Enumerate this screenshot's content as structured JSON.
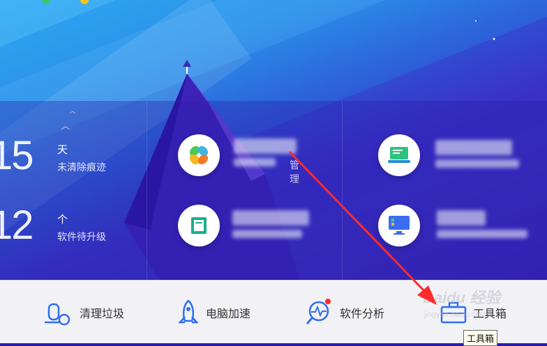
{
  "stats": [
    {
      "number": "15",
      "unit": "天",
      "desc": "未清除痕迹"
    },
    {
      "number": "12",
      "unit": "个",
      "desc": "软件待升级"
    }
  ],
  "cards": [
    {
      "icon": "pinwheel-app-icon",
      "visible_text": "管理"
    },
    {
      "icon": "laptop-app-icon",
      "visible_text": ""
    },
    {
      "icon": "green-document-app-icon",
      "visible_text": ""
    },
    {
      "icon": "monitor-app-icon",
      "visible_text": ""
    }
  ],
  "toolbar": {
    "items": [
      {
        "label": "清理垃圾",
        "icon": "vacuum-cleaner-icon"
      },
      {
        "label": "电脑加速",
        "icon": "rocket-icon"
      },
      {
        "label": "软件分析",
        "icon": "magnifier-chart-icon"
      },
      {
        "label": "工具箱",
        "icon": "toolbox-icon"
      }
    ]
  },
  "tooltip": "工具箱",
  "watermark": {
    "main": "Baidu 经验",
    "sub": "jingyan.baidu.com"
  },
  "colors": {
    "accent_red": "#ff2a2a",
    "primary_blue": "#2f6ff0"
  }
}
